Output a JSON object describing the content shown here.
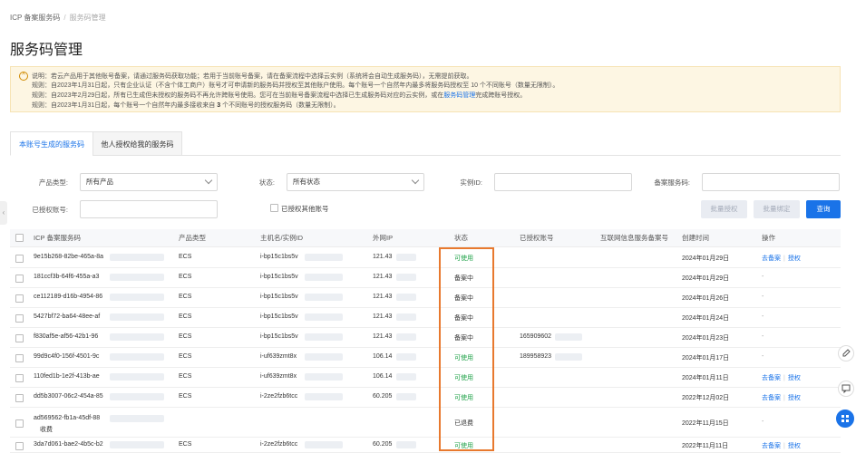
{
  "breadcrumb": {
    "root": "ICP 备案服务码",
    "current": "服务码管理"
  },
  "page_title": "服务码管理",
  "notice": {
    "line1": "说明：若云产品用于其他账号备案，请通过服务码获取功能；若用于当前账号备案，请在备案流程中选择云实例（系统将会自动生成服务码），无需提前获取。",
    "line2": "规则：自2023年1月31日起，只有企业认证（不含个体工商户）账号才可申请新的服务码并授权至其他账户使用。每个账号一个自然年内最多将服务码授权至 10 个不同账号（数量无限制）。",
    "line3_prefix": "规则：自2023年2月29日起，所有已生成但未授权的服务码不再允许跨账号使用。您可在当前账号备案流程中选择已生成服务码对应的云实例，或在",
    "line3_link": "服务码管理",
    "line3_suffix": "完成跨账号授权。",
    "line4_prefix": "规则：自2023年1月31日起，每个账号一个自然年内最多接收来自",
    "line4_bold": "3",
    "line4_suffix": "个不同账号的授权服务码（数量无限制）。"
  },
  "tabs": [
    {
      "label": "本账号生成的服务码",
      "active": true
    },
    {
      "label": "他人授权给我的服务码",
      "active": false
    }
  ],
  "filters": {
    "product_type_label": "产品类型:",
    "product_type_value": "所有产品",
    "status_label": "状态:",
    "status_value": "所有状态",
    "instance_id_label": "实例ID:",
    "service_code_label": "备案服务码:",
    "authorized_account_label": "已授权账号:",
    "authorize_other_label": "已授权其他账号"
  },
  "buttons": {
    "batch_authorize": "批量授权",
    "batch_bind": "批量绑定",
    "search": "查询"
  },
  "table": {
    "headers": [
      "ICP 备案服务码",
      "产品类型",
      "主机名/实例ID",
      "外网IP",
      "状态",
      "已授权账号",
      "互联网信息服务备案号",
      "创建时间",
      "操作"
    ],
    "rows": [
      {
        "code": "9e15b268-82be-465a-8a",
        "product": "ECS",
        "instance": "i-bp15c1bs5v",
        "ip": "121.43",
        "status": "可使用",
        "status_type": "ok",
        "account": "",
        "created": "2024年01月29日",
        "ops": [
          "去备案",
          "授权"
        ]
      },
      {
        "code": "181ccf3b-64f6-455a-a3",
        "product": "ECS",
        "instance": "i-bp15c1bs5v",
        "ip": "121.43",
        "status": "备案中",
        "status_type": "wait",
        "account": "",
        "created": "2024年01月29日",
        "ops": []
      },
      {
        "code": "ce112189-d16b-4954-86",
        "product": "ECS",
        "instance": "i-bp15c1bs5v",
        "ip": "121.43",
        "status": "备案中",
        "status_type": "wait",
        "account": "",
        "created": "2024年01月26日",
        "ops": []
      },
      {
        "code": "5427bf72-ba64-48ee-af",
        "product": "ECS",
        "instance": "i-bp15c1bs5v",
        "ip": "121.43",
        "status": "备案中",
        "status_type": "wait",
        "account": "",
        "created": "2024年01月24日",
        "ops": []
      },
      {
        "code": "f830af5e-af56-42b1-96",
        "product": "ECS",
        "instance": "i-bp15c1bs5v",
        "ip": "121.43",
        "status": "备案中",
        "status_type": "wait",
        "account": "165909602",
        "created": "2024年01月23日",
        "ops": []
      },
      {
        "code": "99d9c4f0-156f-4501-9c",
        "product": "ECS",
        "instance": "i-uf639zmt8x",
        "ip": "106.14",
        "status": "可使用",
        "status_type": "ok",
        "account": "189958923",
        "created": "2024年01月17日",
        "ops": []
      },
      {
        "code": "110fed1b-1e2f-413b-ae",
        "product": "ECS",
        "instance": "i-uf639zmt8x",
        "ip": "106.14",
        "status": "可使用",
        "status_type": "ok",
        "account": "",
        "created": "2024年01月11日",
        "ops": [
          "去备案",
          "授权"
        ]
      },
      {
        "code": "dd5b3007-06c2-454a-85",
        "product": "ECS",
        "instance": "i-2ze2fzb6tcc",
        "ip": "60.205",
        "status": "可使用",
        "status_type": "ok",
        "account": "",
        "created": "2022年12月02日",
        "ops": [
          "去备案",
          "授权"
        ]
      },
      {
        "code": "ad569562-fb1a-45df-88",
        "code2": "收费",
        "product": "",
        "instance": "",
        "ip": "",
        "status": "已退费",
        "status_type": "wait",
        "account": "",
        "created": "2022年11月15日",
        "ops": []
      },
      {
        "code": "3da7d061-baе2-4b5c-b2",
        "product": "ECS",
        "instance": "i-2ze2fzb6tcc",
        "ip": "60.205",
        "status": "可使用",
        "status_type": "ok",
        "account": "",
        "created": "2022年11月11日",
        "ops": [
          "去备案",
          "授权"
        ]
      }
    ]
  },
  "side_toggle": "‹"
}
